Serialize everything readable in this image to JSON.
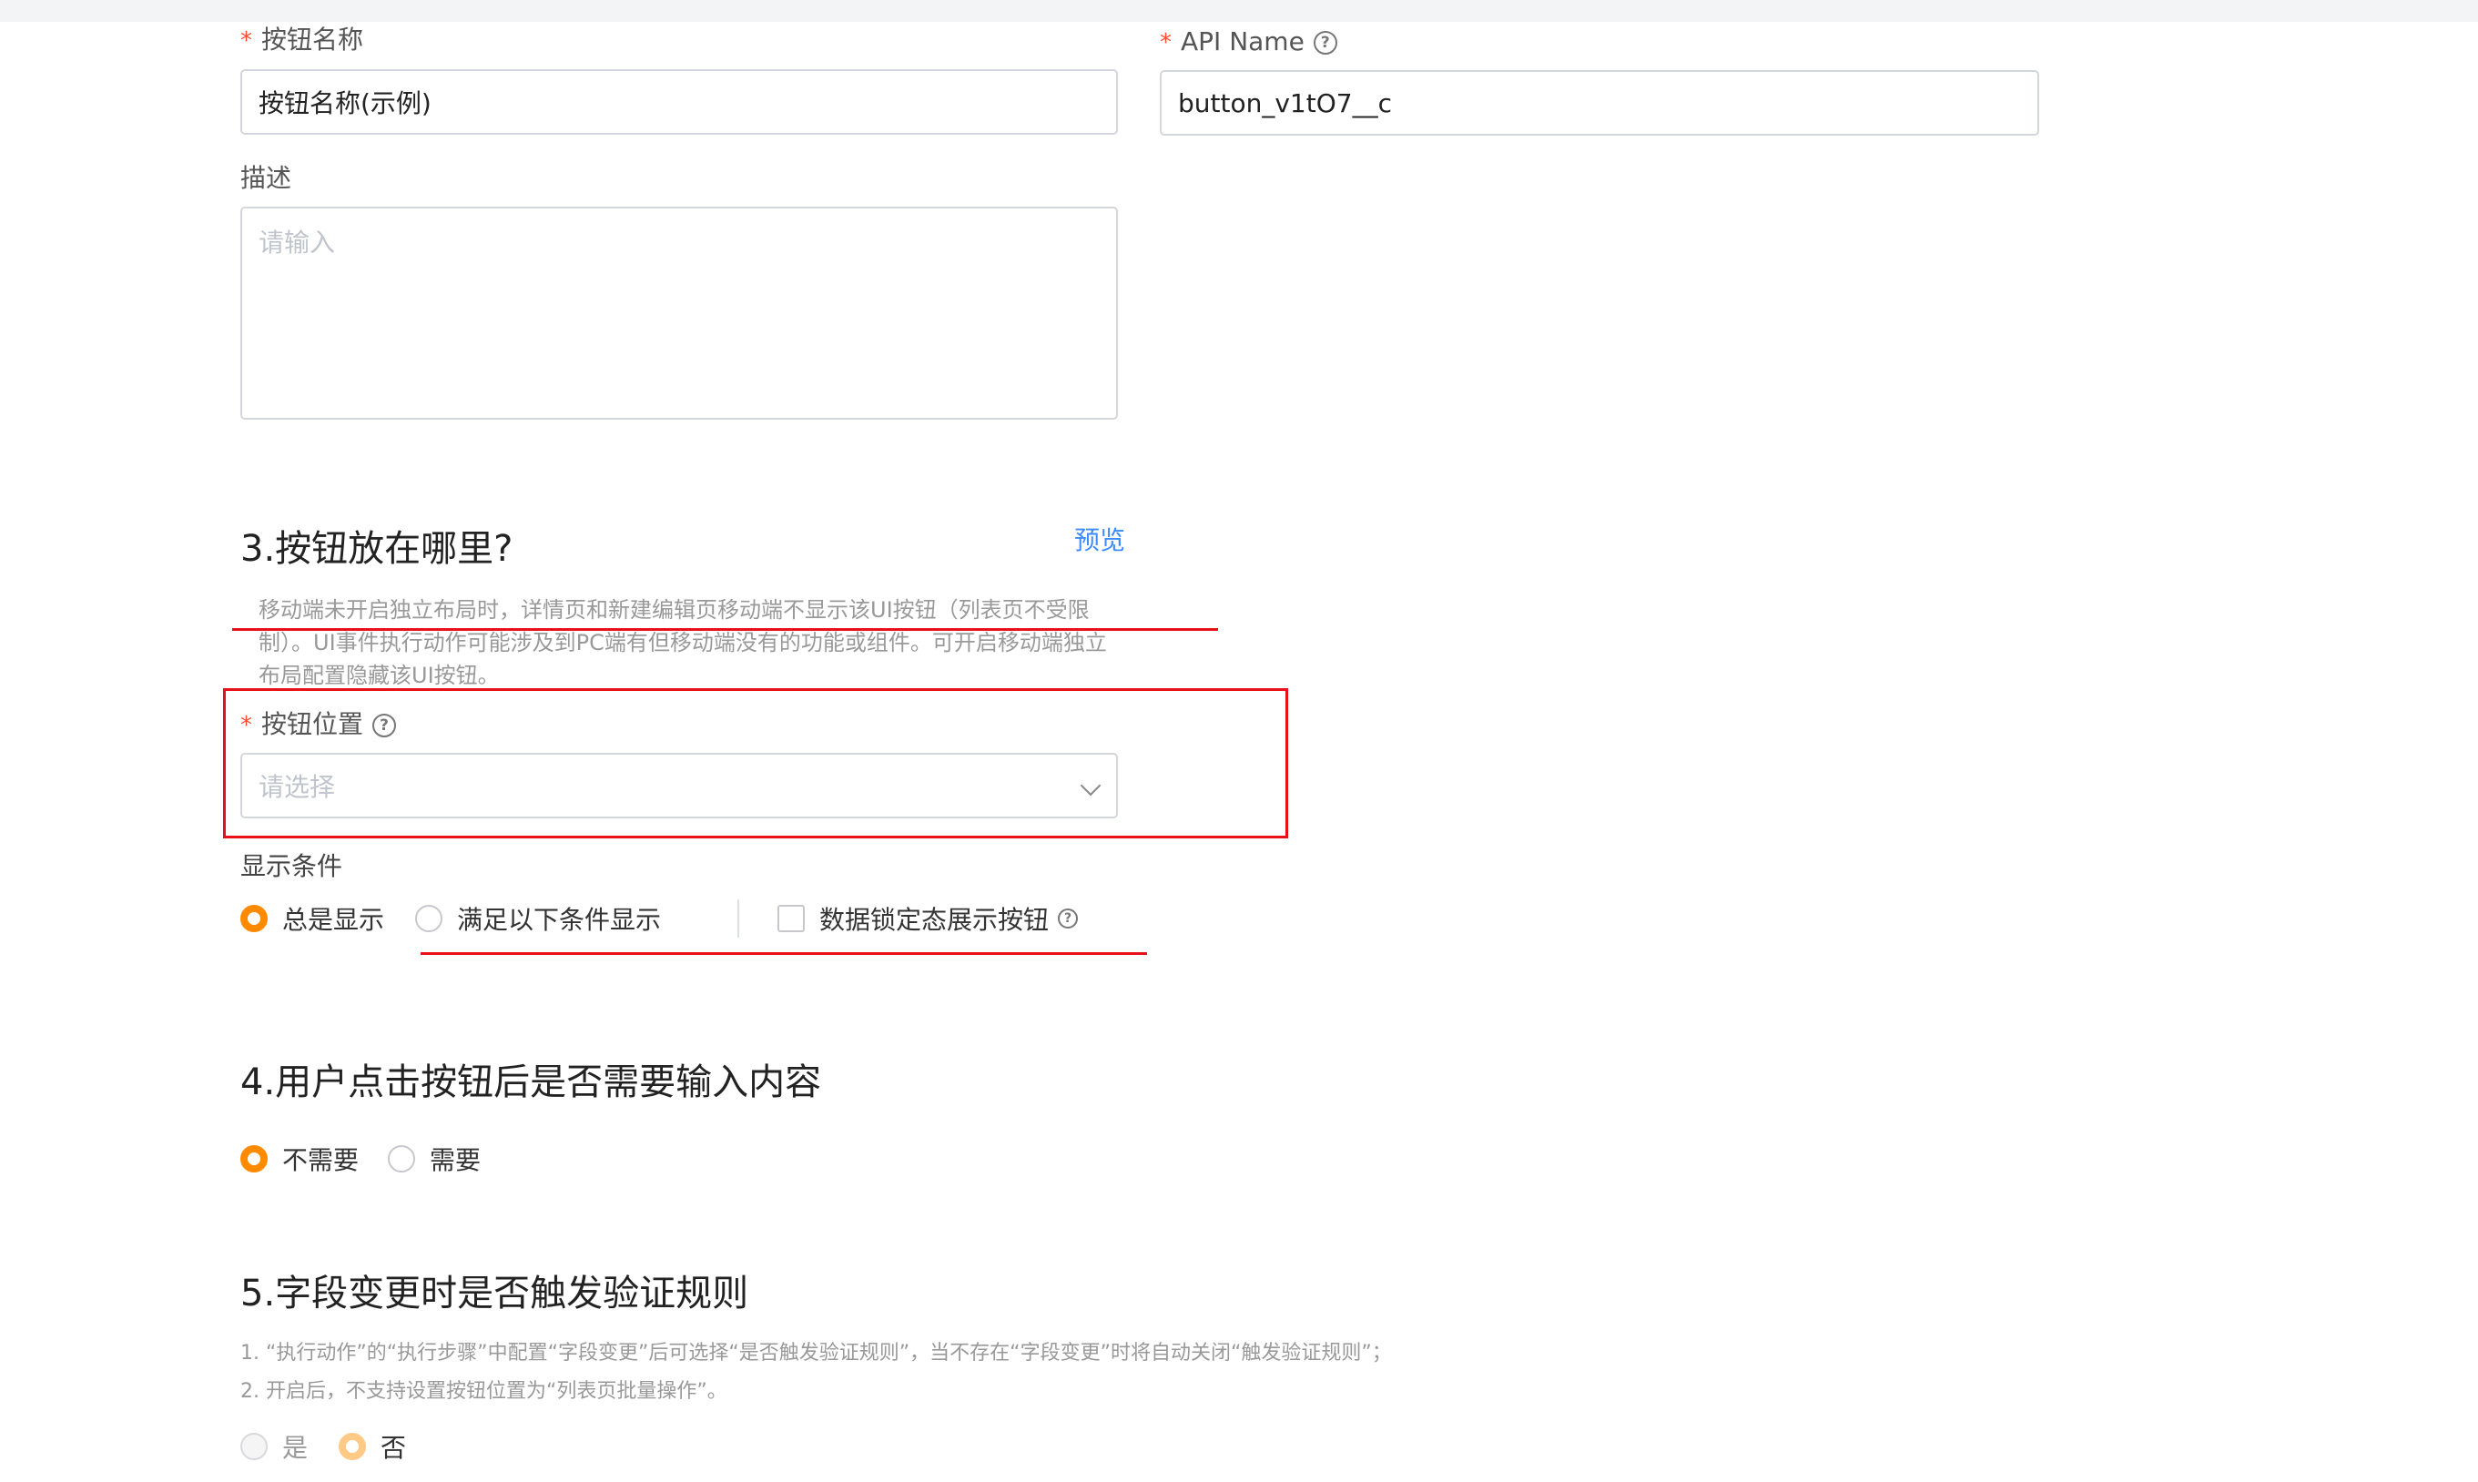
{
  "form": {
    "button_name": {
      "required_mark": "*",
      "label": "按钮名称",
      "value": "按钮名称(示例)"
    },
    "api_name": {
      "required_mark": "*",
      "label": "API Name",
      "help_icon": "question-circle-icon",
      "value": "button_v1tO7__c"
    },
    "description": {
      "label": "描述",
      "placeholder": "请输入"
    }
  },
  "section3": {
    "title": "3.按钮放在哪里?",
    "preview_link": "预览",
    "note_lines": [
      "移动端未开启独立布局时，详情页和新建编辑页移动端不显示该UI按钮（列表页不受限",
      "制）。UI事件执行动作可能涉及到PC端有但移动端没有的功能或组件。可开启移动端独立",
      "布局配置隐藏该UI按钮。"
    ],
    "button_position": {
      "required_mark": "*",
      "label": "按钮位置",
      "help_icon": "question-circle-icon",
      "placeholder": "请选择",
      "dropdown_icon": "chevron-down-icon"
    },
    "display_condition": {
      "label": "显示条件",
      "options": [
        {
          "label": "总是显示",
          "selected": true
        },
        {
          "label": "满足以下条件显示",
          "selected": false
        }
      ],
      "checkbox_label": "数据锁定态展示按钮",
      "checkbox_checked": false
    }
  },
  "section4": {
    "title": "4.用户点击按钮后是否需要输入内容",
    "options": [
      {
        "label": "不需要",
        "selected": true
      },
      {
        "label": "需要",
        "selected": false
      }
    ]
  },
  "section5": {
    "title": "5.字段变更时是否触发验证规则",
    "notes": [
      "1. “执行动作”的“执行步骤”中配置“字段变更”后可选择“是否触发验证规则”，当不存在“字段变更”时将自动关闭“触发验证规则”；",
      "2. 开启后，不支持设置按钮位置为“列表页批量操作”。"
    ],
    "options": [
      {
        "label": "是",
        "selected": false
      },
      {
        "label": "否",
        "selected": true
      }
    ]
  },
  "colors": {
    "accent": "#ff8a00",
    "link": "#3c8cff",
    "annotation_red": "#e8111a",
    "required": "#ff4d32"
  }
}
